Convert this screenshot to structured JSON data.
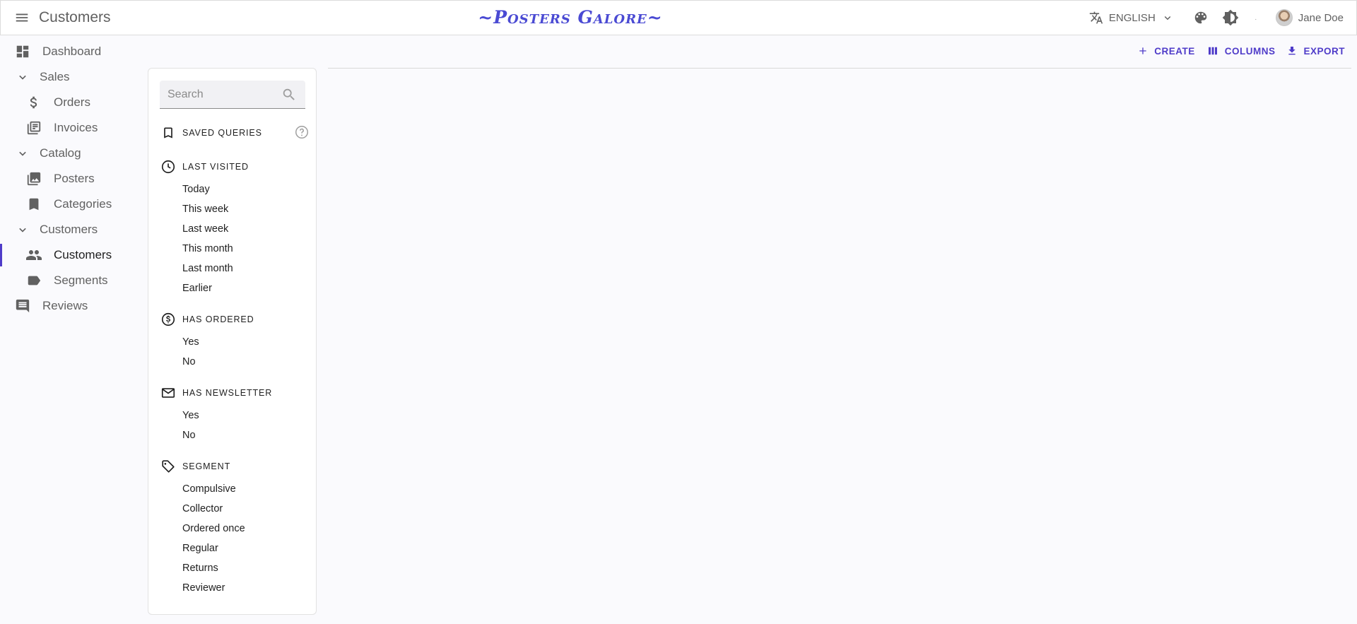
{
  "appbar": {
    "title": "Customers",
    "brand": "~Posters Galore~",
    "language": "ENGLISH",
    "user_name": "Jane Doe",
    "icons": [
      "menu-icon",
      "translate-icon",
      "chevron-down-icon",
      "palette-icon",
      "brightness-icon",
      "user-avatar"
    ]
  },
  "sidebar": {
    "dashboard": "Dashboard",
    "sales": "Sales",
    "orders": "Orders",
    "invoices": "Invoices",
    "catalog": "Catalog",
    "posters": "Posters",
    "categories": "Categories",
    "customers_group": "Customers",
    "customers": "Customers",
    "segments": "Segments",
    "reviews": "Reviews",
    "active_item": "Customers",
    "accent_color": "#4f3cc9"
  },
  "filter": {
    "search_placeholder": "Search",
    "saved_queries": "SAVED QUERIES",
    "last_visited": {
      "title": "LAST VISITED",
      "items": [
        "Today",
        "This week",
        "Last week",
        "This month",
        "Last month",
        "Earlier"
      ]
    },
    "has_ordered": {
      "title": "HAS ORDERED",
      "items": [
        "Yes",
        "No"
      ]
    },
    "has_newsletter": {
      "title": "HAS NEWSLETTER",
      "items": [
        "Yes",
        "No"
      ]
    },
    "segment": {
      "title": "SEGMENT",
      "items": [
        "Compulsive",
        "Collector",
        "Ordered once",
        "Regular",
        "Returns",
        "Reviewer"
      ]
    }
  },
  "toolbar": {
    "create": "CREATE",
    "columns": "COLUMNS",
    "export": "EXPORT"
  }
}
